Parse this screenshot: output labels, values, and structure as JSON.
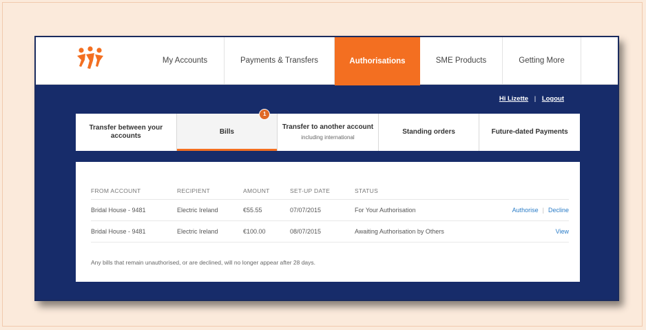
{
  "nav": {
    "tabs": [
      {
        "label": "My Accounts"
      },
      {
        "label": "Payments & Transfers"
      },
      {
        "label": "Authorisations"
      },
      {
        "label": "SME Products"
      },
      {
        "label": "Getting More"
      }
    ],
    "active_index": 2
  },
  "user": {
    "greeting": "Hi Lizette",
    "separator": "|",
    "logout": "Logout"
  },
  "sub_tabs": [
    {
      "label": "Transfer between your accounts",
      "sub": ""
    },
    {
      "label": "Bills",
      "sub": "",
      "badge": "1"
    },
    {
      "label": "Transfer to another account",
      "sub": "including international"
    },
    {
      "label": "Standing orders",
      "sub": ""
    },
    {
      "label": "Future-dated Payments",
      "sub": ""
    }
  ],
  "bills": {
    "headers": [
      "FROM ACCOUNT",
      "RECIPIENT",
      "AMOUNT",
      "SET-UP DATE",
      "STATUS"
    ],
    "rows": [
      {
        "from": "Bridal House - 9481",
        "recipient": "Electric Ireland",
        "amount": "€55.55",
        "date": "07/07/2015",
        "status": "For Your Authorisation",
        "actions": [
          "Authorise",
          "Decline"
        ]
      },
      {
        "from": "Bridal House - 9481",
        "recipient": "Electric Ireland",
        "amount": "€100.00",
        "date": "08/07/2015",
        "status": "Awaiting Authorisation by Others",
        "actions": [
          "View"
        ]
      }
    ],
    "action_separator": "|",
    "footnote": "Any bills that remain unauthorised, or are declined, will no longer appear after 28 days."
  },
  "colors": {
    "brand_orange": "#f36f21",
    "navy": "#172c6a",
    "link_blue": "#2a7cc7",
    "page_bg": "#fbeadb"
  }
}
